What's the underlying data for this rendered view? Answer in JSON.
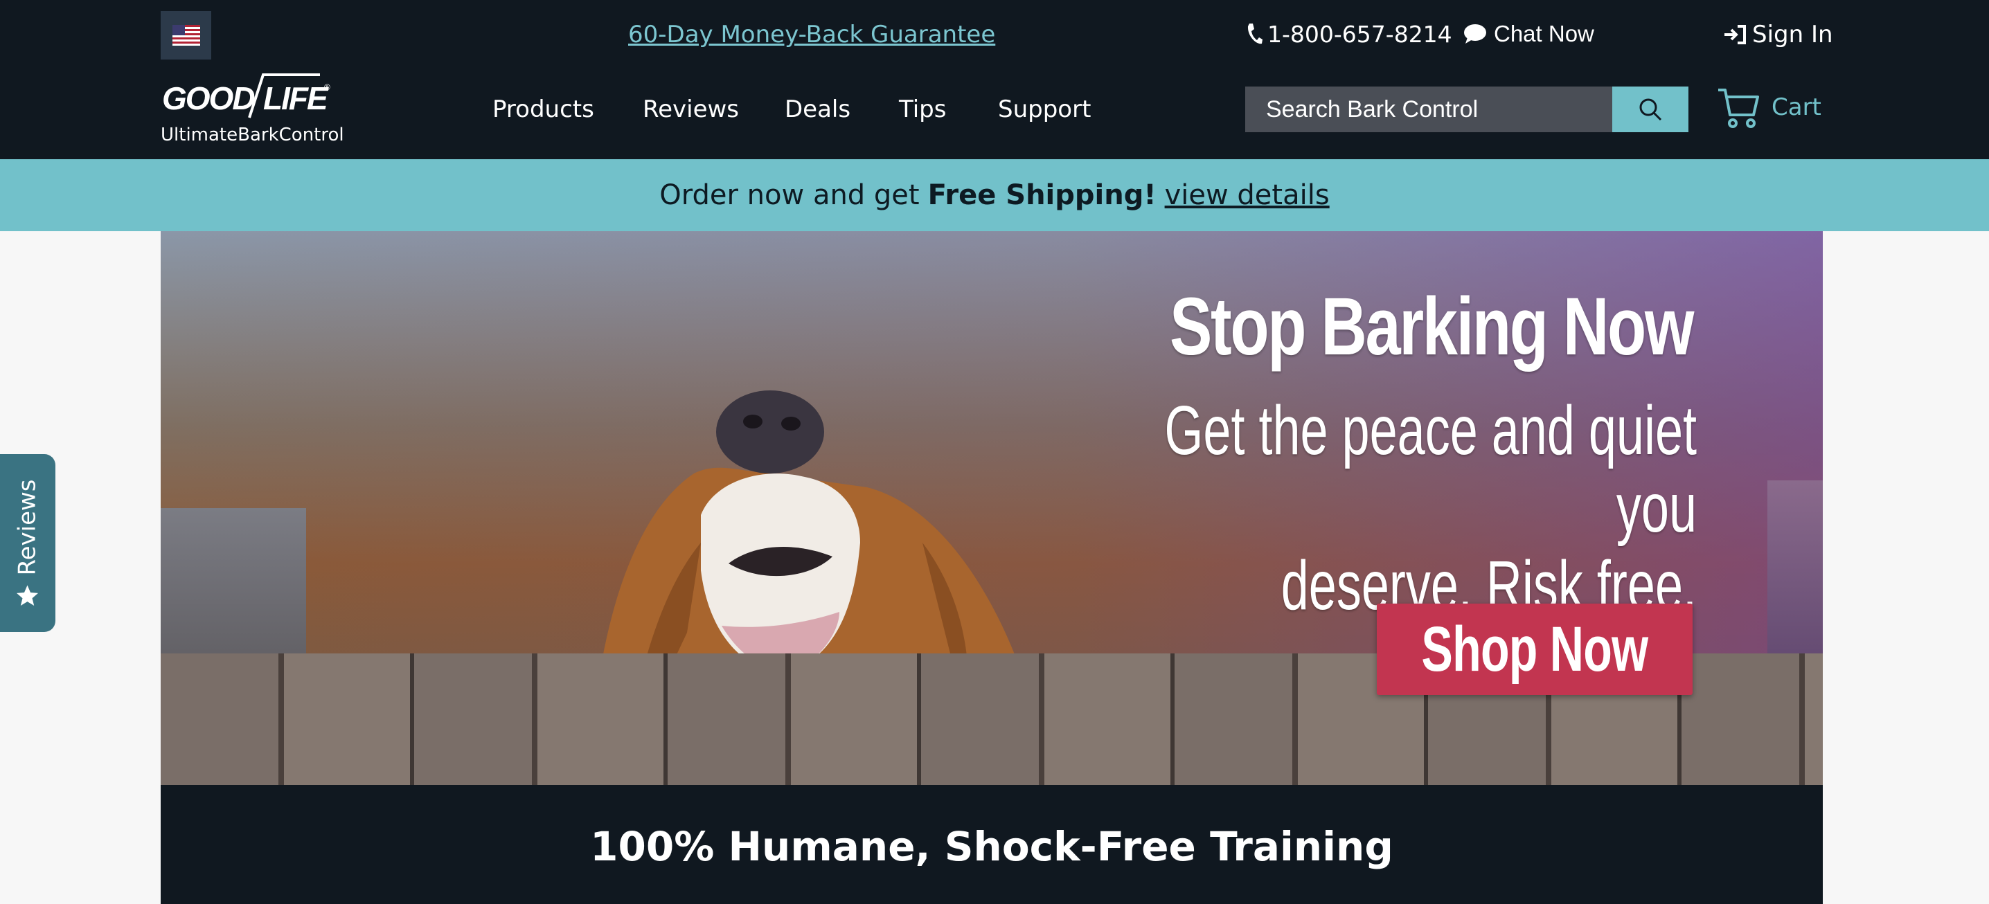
{
  "header": {
    "guarantee_link": "60-Day Money-Back Guarantee",
    "phone": "1-800-657-8214",
    "chat_label": "Chat Now",
    "signin_label": "Sign In",
    "logo_text": "GOOD LIFE",
    "logo_tagline": "UltimateBarkControl"
  },
  "nav": {
    "items": [
      {
        "label": "Products"
      },
      {
        "label": "Reviews"
      },
      {
        "label": "Deals"
      },
      {
        "label": "Tips"
      },
      {
        "label": "Support"
      }
    ]
  },
  "search": {
    "placeholder": "Search Bark Control"
  },
  "cart": {
    "label": "Cart"
  },
  "promo": {
    "prefix": "Order now and get",
    "highlight": "Free Shipping!",
    "link": "view details"
  },
  "hero": {
    "title": "Stop Barking Now",
    "subtitle_line1": "Get the peace and quiet you",
    "subtitle_line2": "deserve. Risk free.",
    "cta": "Shop Now"
  },
  "banner": {
    "text": "100% Humane, Shock-Free Training"
  },
  "side_tab": {
    "label": "Reviews"
  },
  "colors": {
    "dark": "#101820",
    "accent": "#72c1ca",
    "cta": "#c23550",
    "side_tab": "#3a7382"
  }
}
